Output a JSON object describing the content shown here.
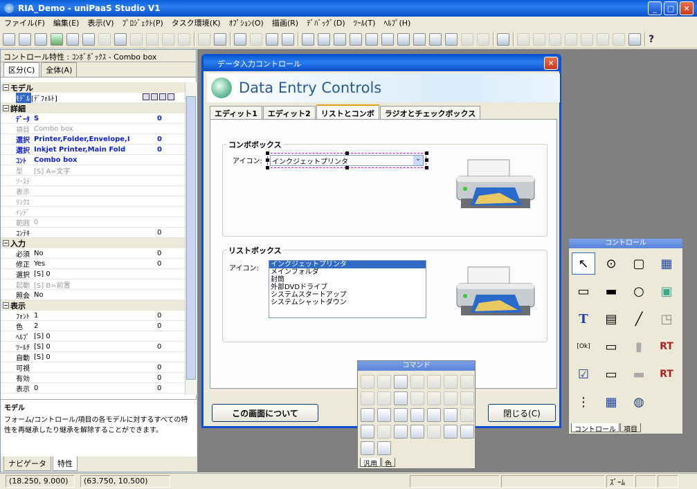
{
  "window": {
    "title": "RIA_Demo - uniPaaS Studio V1"
  },
  "menu": [
    "ファイル(F)",
    "編集(E)",
    "表示(V)",
    "ﾌﾟﾛｼﾞｪｸﾄ(P)",
    "タスク環境(K)",
    "ｵﾌﾟｼｮﾝ(O)",
    "描画(R)",
    "ﾃﾞﾊﾞｯｸﾞ(D)",
    "ﾂｰﾙ(T)",
    "ﾍﾙﾌﾟ(H)"
  ],
  "props": {
    "title": "コントロール特性 : ｺﾝﾎﾞﾎﾞｯｸｽ - Combo box",
    "tab_section": "区分(C)",
    "tab_all": "全体(A)",
    "sections": {
      "model": "モデル",
      "detail": "詳細",
      "input": "入力",
      "display": "表示"
    },
    "rows_model": [
      {
        "label": "ﾓﾃﾞﾙ",
        "value": "[ﾃﾞﾌｫﾙﾄ]",
        "num": ""
      }
    ],
    "rows_detail": [
      {
        "label": "ﾃﾞｰﾀ",
        "value": "S",
        "num": "0"
      },
      {
        "label": "項目",
        "value": "Combo box",
        "num": ""
      },
      {
        "label": "選択",
        "value": "Printer,Folder,Envelope,I",
        "num": "0"
      },
      {
        "label": "選択",
        "value": "Inkjet Printer,Main Fold",
        "num": "0"
      },
      {
        "label": "ｺﾝﾄ",
        "value": "Combo box",
        "num": ""
      },
      {
        "label": "型",
        "value": "[S] A=文字",
        "num": ""
      },
      {
        "label": "ｿｰｽﾃ",
        "value": "",
        "num": ""
      },
      {
        "label": "表示",
        "value": "",
        "num": ""
      },
      {
        "label": "ﾘﾝｸｴ",
        "value": "",
        "num": ""
      },
      {
        "label": "ｲﾝﾃﾞ",
        "value": "",
        "num": ""
      },
      {
        "label": "範囲",
        "value": "0",
        "num": ""
      },
      {
        "label": "ｺﾝﾃｷ",
        "value": "",
        "num": "0"
      }
    ],
    "rows_input": [
      {
        "label": "必須",
        "value": "No",
        "num": "0"
      },
      {
        "label": "修正",
        "value": "Yes",
        "num": "0"
      },
      {
        "label": "選択",
        "value": "[S] 0",
        "num": ""
      },
      {
        "label": "起動",
        "value": "[S] B=前置",
        "num": ""
      },
      {
        "label": "照会",
        "value": "No",
        "num": ""
      }
    ],
    "rows_display": [
      {
        "label": "ﾌｫﾝﾄ",
        "value": "1",
        "num": "0"
      },
      {
        "label": "色",
        "value": "2",
        "num": "0"
      },
      {
        "label": "ﾍﾙﾌﾟ",
        "value": "[S] 0",
        "num": ""
      },
      {
        "label": "ﾂｰﾙﾁ",
        "value": "[S] 0",
        "num": "0"
      },
      {
        "label": "自動",
        "value": "[S] 0",
        "num": ""
      },
      {
        "label": "可視",
        "value": "",
        "num": "0"
      },
      {
        "label": "有効",
        "value": "",
        "num": "0"
      },
      {
        "label": "表示",
        "value": "0",
        "num": "0"
      }
    ],
    "desc_title": "モデル",
    "desc_text": "フォーム/コントロール/項目の各モデルに対するすべての特性を再継承したり継承を解除することができます。",
    "bottom_tab_nav": "ナビゲータ",
    "bottom_tab_prop": "特性"
  },
  "dialog": {
    "title": "データ入力コントロール",
    "banner": "Data Entry Controls",
    "tabs": [
      "エディット1",
      "エディット2",
      "リストとコンボ",
      "ラジオとチェックボックス"
    ],
    "combo_group": "コンボボックス",
    "combo_label": "アイコン:",
    "combo_value": "インクジェットプリンタ",
    "list_group": "リストボックス",
    "list_label": "アイコン:",
    "list_items": [
      "インクジェットプリンタ",
      "メインフォルダ",
      "封筒",
      "外部DVDドライブ",
      "システムスタートアップ",
      "システムシャットダウン"
    ],
    "about_button": "この画面について",
    "close_button": "閉じる(C)"
  },
  "command_palette": {
    "title": "コマンド",
    "tab1": "汎用",
    "tab2": "色"
  },
  "control_palette": {
    "title": "コントロール",
    "tab1": "コントロール",
    "tab2": "項目"
  },
  "status": {
    "pos1": "(18.250, 9.000)",
    "pos2": "(63.750, 10.500)",
    "zoom": "ｽﾞｰﾑ"
  }
}
